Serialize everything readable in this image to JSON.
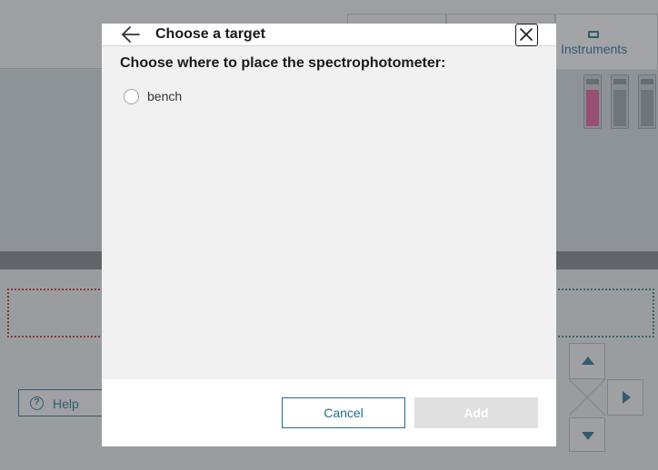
{
  "background": {
    "instruments_tab_label": "Instruments",
    "help_label": "Help",
    "help_icon": "question-circle-icon"
  },
  "dialog": {
    "title": "Choose a target",
    "back_icon": "arrow-left-icon",
    "close_icon": "close-icon",
    "prompt": "Choose where to place the spectrophotometer:",
    "options": [
      {
        "label": "bench",
        "selected": false
      }
    ],
    "cancel_label": "Cancel",
    "add_label": "Add",
    "add_enabled": false
  },
  "colors": {
    "accent": "#1f6c8c",
    "dialog_body": "#f1f1f1",
    "disabled_button": "#e0e0e0"
  }
}
